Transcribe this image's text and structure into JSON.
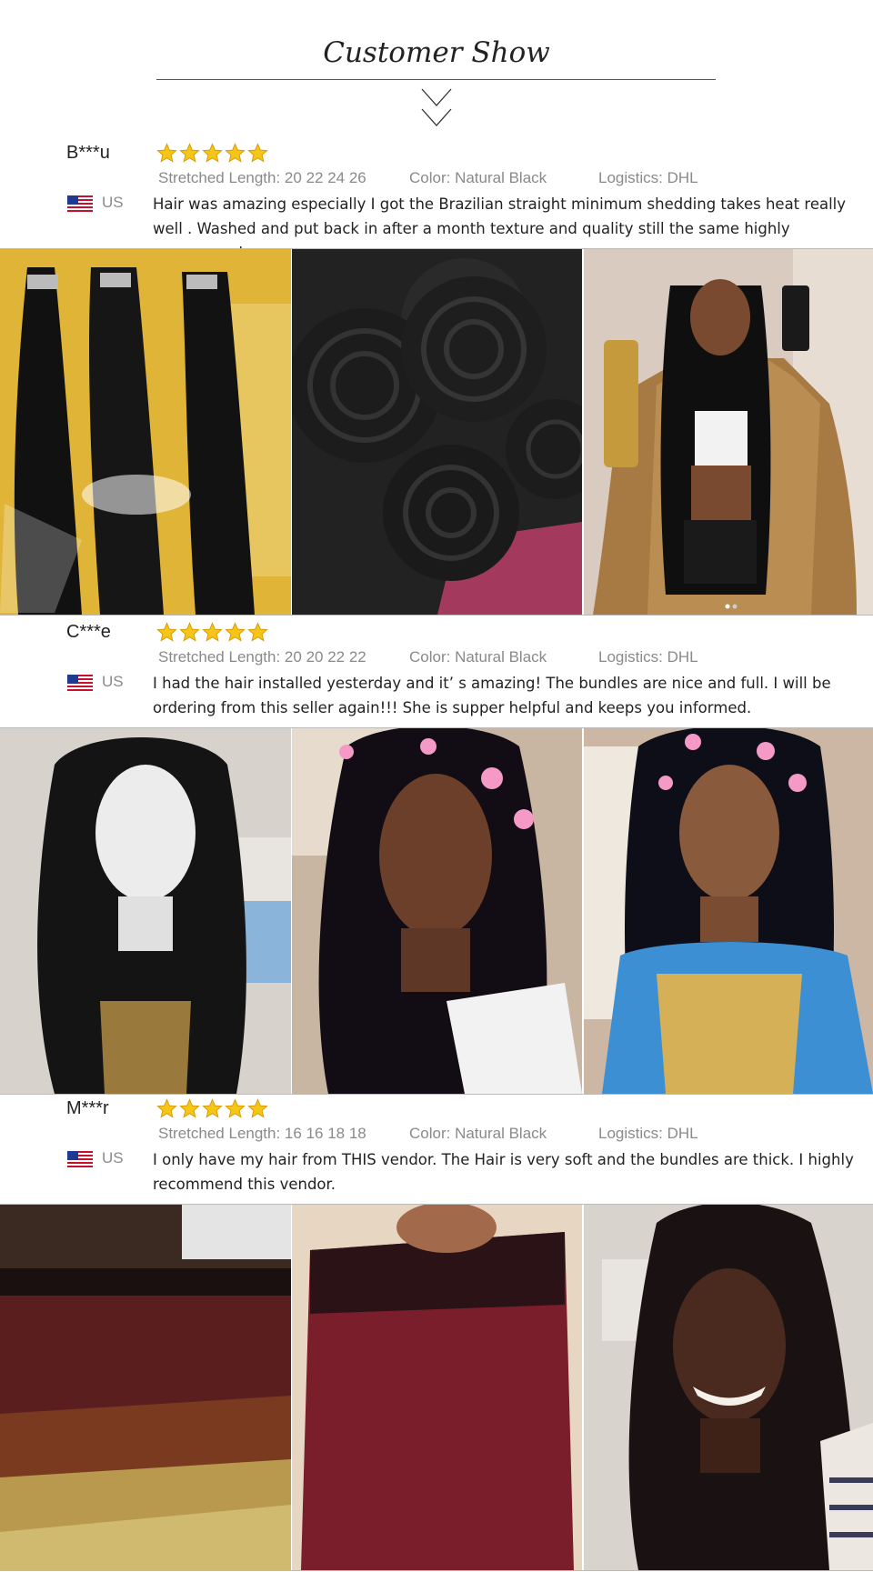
{
  "header": {
    "title": "Customer Show"
  },
  "reviews": [
    {
      "name": "B***u",
      "rating": 5,
      "length_label": "Stretched Length: 20 22 24 26",
      "color_label": "Color:  Natural Black",
      "logistics_label": "Logistics: DHL",
      "country": "US",
      "text": "Hair was amazing especially I got the Brazilian straight minimum shedding takes heat really well . Washed and put back in after a month texture and quality still the same highly recommend.",
      "photos": [
        "straight-bundles-photo",
        "bundle-coils-photo",
        "selfie-gold-jacket-photo"
      ]
    },
    {
      "name": "C***e",
      "rating": 5,
      "length_label": "Stretched Length: 20 20 22 22",
      "color_label": "Color:  Natural Black",
      "logistics_label": "Logistics: DHL",
      "country": "US",
      "text": " I had the hair installed yesterday and it’  s amazing! The bundles are nice and full. I will be ordering from this seller again!!! She is supper helpful and keeps you informed.",
      "photos": [
        "wig-on-mannequin-photo",
        "selfie-hearts-photo",
        "selfie-tie-dye-photo"
      ]
    },
    {
      "name": "M***r",
      "rating": 5,
      "length_label": "Stretched Length: 16 16 18 18",
      "color_label": "Color: Natural Black",
      "logistics_label": "Logistics: DHL",
      "country": "US",
      "text": "I only have my hair from THIS vendor. The Hair is very soft and the bundles are thick. I highly recommend this vendor.",
      "photos": [
        "ombre-bundles-photo",
        "ombre-hair-held-photo",
        "smiling-selfie-photo"
      ]
    }
  ],
  "colors": {
    "star": "#f5c518",
    "star_outline": "#d99a00",
    "meta_text": "#8a8a8a",
    "divider": "#bbbbbb"
  }
}
